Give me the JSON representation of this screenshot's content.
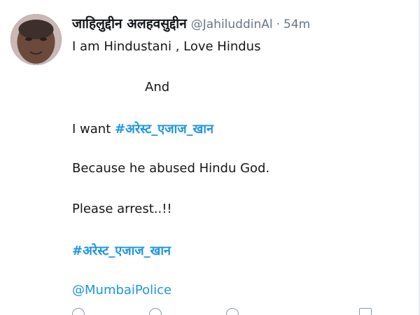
{
  "tweet": {
    "display_name": "जाहिलुद्दीन अलहवसुद्दीन",
    "handle": "@JahiluddinAl",
    "separator": "·",
    "time": "54m",
    "lines": {
      "l1": "I am Hindustani , Love Hindus",
      "l2": "And",
      "l3_prefix": "I want ",
      "l3_hashtag": "#अरेस्ट_एजाज_खान",
      "l4": "Because he abused Hindu God.",
      "l5": "Please arrest..!!",
      "l6_hashtag": "#अरेस्ट_एजाज_खान",
      "l7_mention": "@MumbaiPolice"
    }
  },
  "colors": {
    "link": "#1b95e0",
    "text": "#14171a",
    "muted": "#657786"
  },
  "icons": {
    "reply": "reply-icon",
    "retweet": "retweet-icon",
    "like": "like-icon",
    "share": "share-icon"
  }
}
